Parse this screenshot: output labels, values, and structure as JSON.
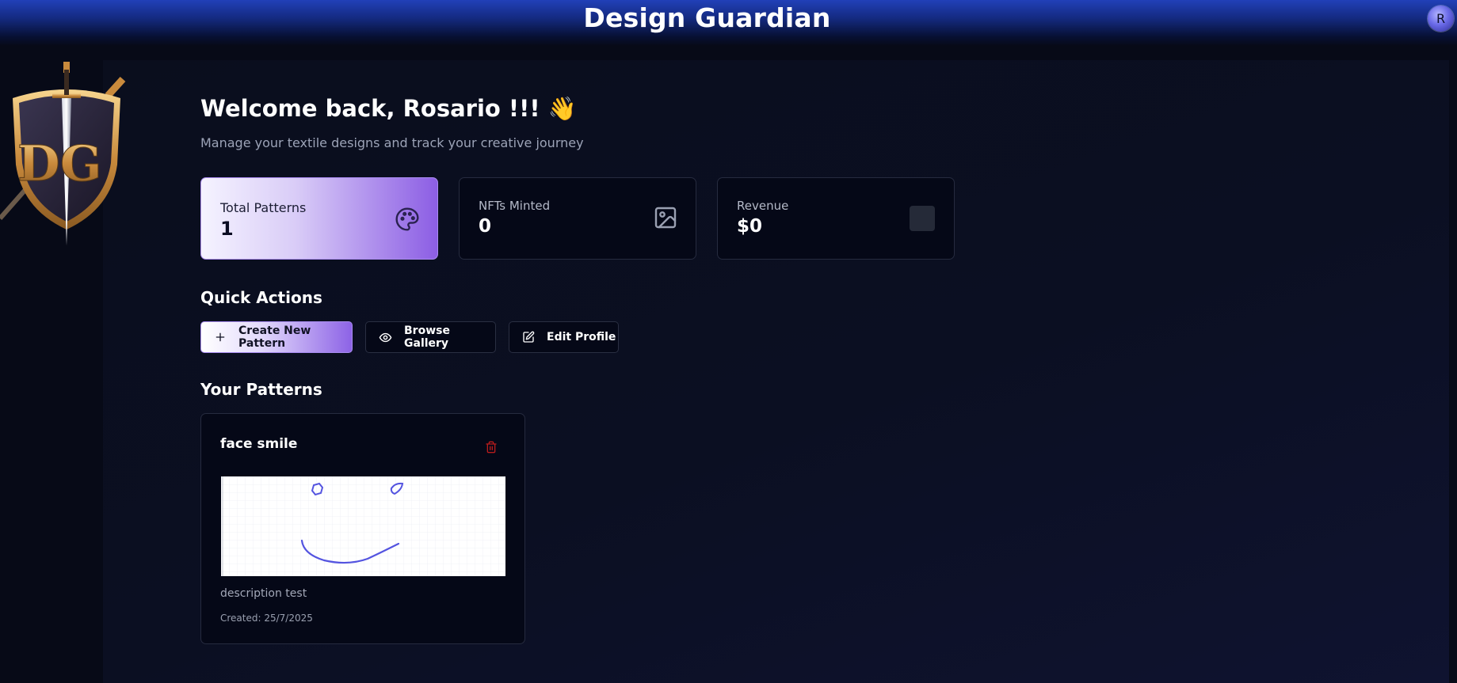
{
  "header": {
    "app_title": "Design Guardian",
    "avatar_initial": "R"
  },
  "logo": {
    "text": "DG"
  },
  "welcome": {
    "greeting": "Welcome back, Rosario !!! 👋",
    "subtitle": "Manage your textile designs and track your creative journey"
  },
  "stats": [
    {
      "label": "Total Patterns",
      "value": "1",
      "icon": "palette-icon"
    },
    {
      "label": "NFTs Minted",
      "value": "0",
      "icon": "image-icon"
    },
    {
      "label": "Revenue",
      "value": "$0",
      "icon": "placeholder-box"
    }
  ],
  "quick_actions": {
    "title": "Quick Actions",
    "buttons": [
      {
        "label": "Create New Pattern",
        "icon": "plus-icon"
      },
      {
        "label": "Browse Gallery",
        "icon": "eye-icon"
      },
      {
        "label": "Edit Profile",
        "icon": "edit-icon"
      }
    ]
  },
  "patterns": {
    "title": "Your Patterns",
    "items": [
      {
        "name": "face smile",
        "description": "description test",
        "created": "Created: 25/7/2025",
        "delete_icon": "trash-icon"
      }
    ]
  },
  "colors": {
    "accent_purple": "#8c5ee4",
    "header_blue": "#2140b8",
    "background": "#070a17",
    "delete_red": "#b91c1c",
    "sketch_stroke": "#5454e0"
  }
}
